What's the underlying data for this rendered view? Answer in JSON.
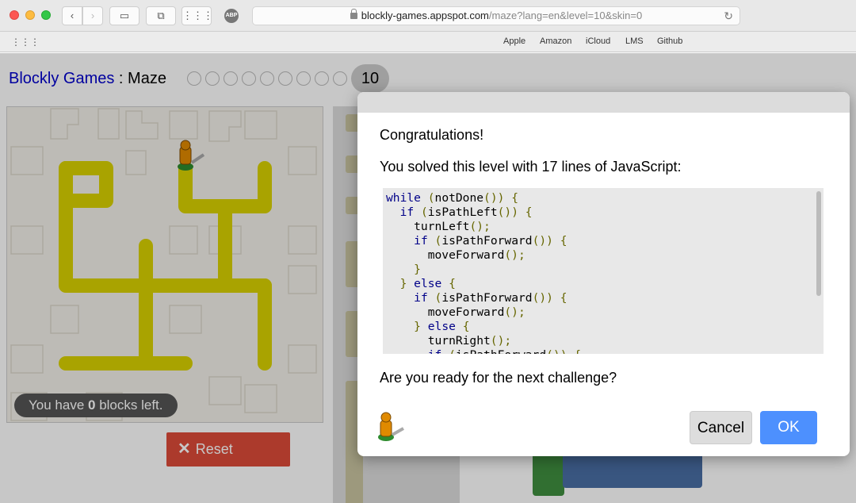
{
  "browser": {
    "url_host": "blockly-games.appspot.com",
    "url_path": "/maze?lang=en&level=10&skin=0",
    "favorites": [
      "Apple",
      "Amazon",
      "iCloud",
      "LMS",
      "Github"
    ],
    "abp_label": "ABP"
  },
  "page": {
    "title_link": "Blockly Games",
    "title_separator": " : ",
    "title_game": "Maze",
    "levels_total": 10,
    "level_current": "10",
    "blocks_left_prefix": "You have ",
    "blocks_left_count": "0",
    "blocks_left_suffix": " blocks left.",
    "reset_label": "Reset"
  },
  "dialog": {
    "heading": "Congratulations!",
    "solved_text": "You solved this level with 17 lines of JavaScript:",
    "code_lines": [
      "while (notDone()) {",
      "  if (isPathLeft()) {",
      "    turnLeft();",
      "    if (isPathForward()) {",
      "      moveForward();",
      "    }",
      "  } else {",
      "    if (isPathForward()) {",
      "      moveForward();",
      "    } else {",
      "      turnRight();",
      "      if (isPathForward()) {"
    ],
    "question": "Are you ready for the next challenge?",
    "cancel_label": "Cancel",
    "ok_label": "OK"
  },
  "colors": {
    "path": "#d9d100",
    "reset": "#dd4b39",
    "ok": "#4d90fe",
    "link": "#0000cc"
  }
}
